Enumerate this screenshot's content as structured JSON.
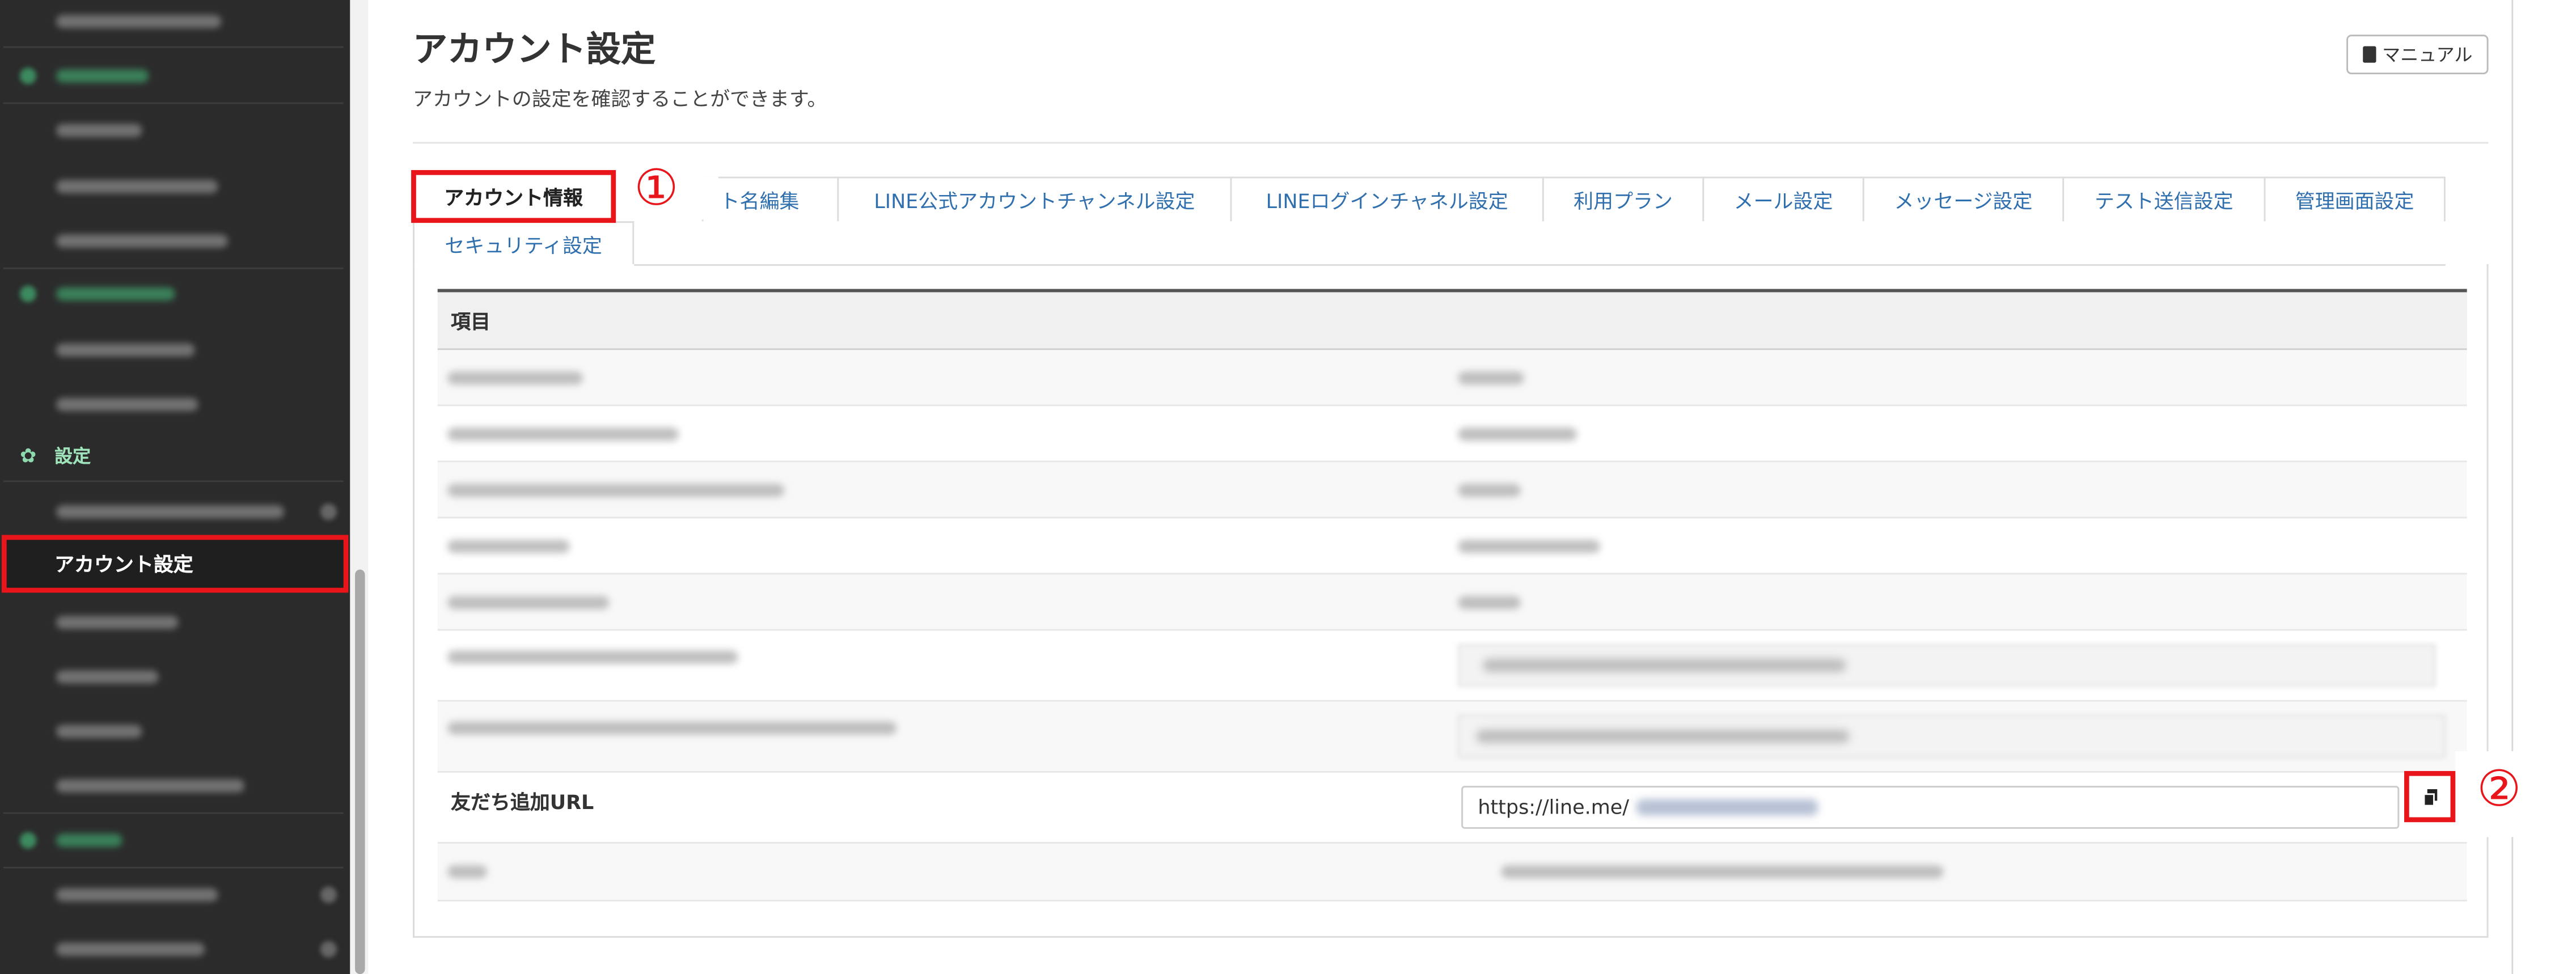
{
  "sidebar": {
    "settings_section_label": "設定",
    "active_item_label": "アカウント設定"
  },
  "header": {
    "title": "アカウント設定",
    "subtitle": "アカウントの設定を確認することができます。",
    "manual_button": "マニュアル"
  },
  "tabs": [
    {
      "label": "アカウント情報",
      "active": true
    },
    {
      "label": "ト名編集"
    },
    {
      "label": "LINE公式アカウントチャンネル設定"
    },
    {
      "label": "LINEログインチャネル設定"
    },
    {
      "label": "利用プラン"
    },
    {
      "label": "メール設定"
    },
    {
      "label": "メッセージ設定"
    },
    {
      "label": "テスト送信設定"
    },
    {
      "label": "管理画面設定"
    },
    {
      "label": "セキュリティ設定"
    }
  ],
  "table": {
    "header": "項目",
    "friend_add_url": {
      "label": "友だち追加URL",
      "value_prefix": "https://line.me/"
    }
  },
  "annotations": {
    "marker_1": "①",
    "marker_2": "②"
  },
  "colors": {
    "highlight": "#e8161a",
    "sidebar_bg": "#2b2b2b",
    "tab_link": "#2f6fae"
  }
}
